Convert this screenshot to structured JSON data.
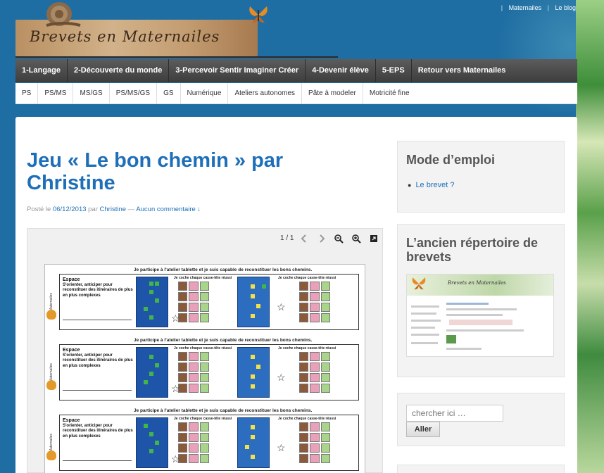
{
  "top_links": [
    "Maternailes",
    "Le blog"
  ],
  "logo": {
    "text": "Brevets en Maternailes"
  },
  "main_nav": [
    "1-Langage",
    "2-Découverte du monde",
    "3-Percevoir Sentir Imaginer Créer",
    "4-Devenir élève",
    "5-EPS",
    "Retour vers Maternailes"
  ],
  "sub_nav": [
    "PS",
    "PS/MS",
    "MS/GS",
    "PS/MS/GS",
    "GS",
    "Numérique",
    "Ateliers autonomes",
    "Pâte à modeler",
    "Motricité fine"
  ],
  "post": {
    "title": "Jeu « Le bon chemin » par Christine",
    "meta_posted": "Posté le",
    "meta_date": "06/12/2013",
    "meta_by": "par",
    "meta_author": "Christine",
    "meta_dash": "—",
    "meta_comments": "Aucun commentaire ↓"
  },
  "viewer": {
    "page_count": "1 / 1",
    "row_heading": "Je participe à l'atelier tablette et je suis capable de reconstituer les bons chemins.",
    "skill_title": "Espace",
    "skill_text": "S'orienter, anticiper pour reconstituer des itinéraires de plus en plus complexes",
    "side_label": "Maternailes",
    "coche_label": "Je coche chaque casse-tête réussi"
  },
  "sidebar": {
    "mode_emploi": {
      "title": "Mode d’emploi",
      "items": [
        "Le brevet ?"
      ]
    },
    "ancien": {
      "title": "L’ancien répertoire de brevets",
      "thumb_title": "Brevets en Maternailes"
    },
    "search": {
      "placeholder": "chercher ici …",
      "button": "Aller"
    }
  },
  "colors": {
    "link": "#1e6fb8",
    "background": "#1f6ea3",
    "nav": "#474747"
  }
}
